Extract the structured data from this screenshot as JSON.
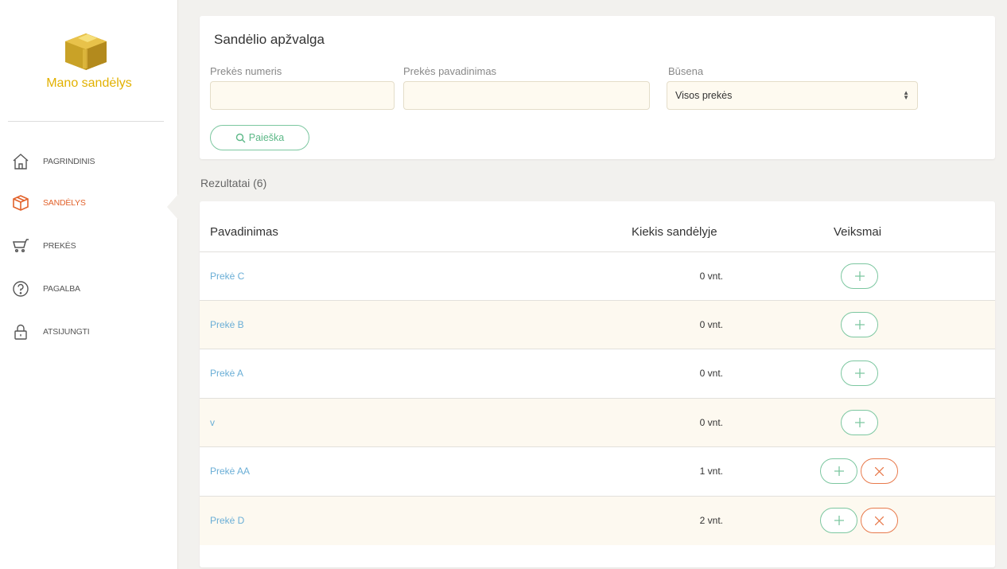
{
  "sidebar": {
    "brand": "Mano sandėlys",
    "items": [
      {
        "label": "PAGRINDINIS",
        "icon": "home-icon"
      },
      {
        "label": "SANDĖLYS",
        "icon": "box-icon",
        "active": true
      },
      {
        "label": "PREKĖS",
        "icon": "cart-icon"
      },
      {
        "label": "PAGALBA",
        "icon": "help-icon"
      },
      {
        "label": "ATSIJUNGTI",
        "icon": "lock-icon"
      }
    ]
  },
  "filter": {
    "title": "Sandėlio apžvalga",
    "number_label": "Prekės numeris",
    "number_value": "",
    "name_label": "Prekės pavadinimas",
    "name_value": "",
    "status_label": "Būsena",
    "status_value": "Visos prekės",
    "search_label": "Paieška"
  },
  "results": {
    "title": "Rezultatai (6)",
    "columns": [
      "Pavadinimas",
      "Kiekis sandėlyje",
      "Veiksmai"
    ],
    "rows": [
      {
        "name": "Prekė C",
        "qty": "0 vnt.",
        "actions": [
          "add"
        ]
      },
      {
        "name": "Prekė B",
        "qty": "0 vnt.",
        "actions": [
          "add"
        ]
      },
      {
        "name": "Prekė A",
        "qty": "0 vnt.",
        "actions": [
          "add"
        ]
      },
      {
        "name": "v",
        "qty": "0 vnt.",
        "actions": [
          "add"
        ]
      },
      {
        "name": "Prekė AA",
        "qty": "1 vnt.",
        "actions": [
          "add",
          "remove"
        ]
      },
      {
        "name": "Prekė D",
        "qty": "2 vnt.",
        "actions": [
          "add",
          "remove"
        ]
      }
    ]
  },
  "colors": {
    "accent_orange": "#e2622b",
    "accent_green": "#7cc7a0",
    "link_blue": "#6aaed6",
    "brand_yellow": "#e2b100"
  }
}
